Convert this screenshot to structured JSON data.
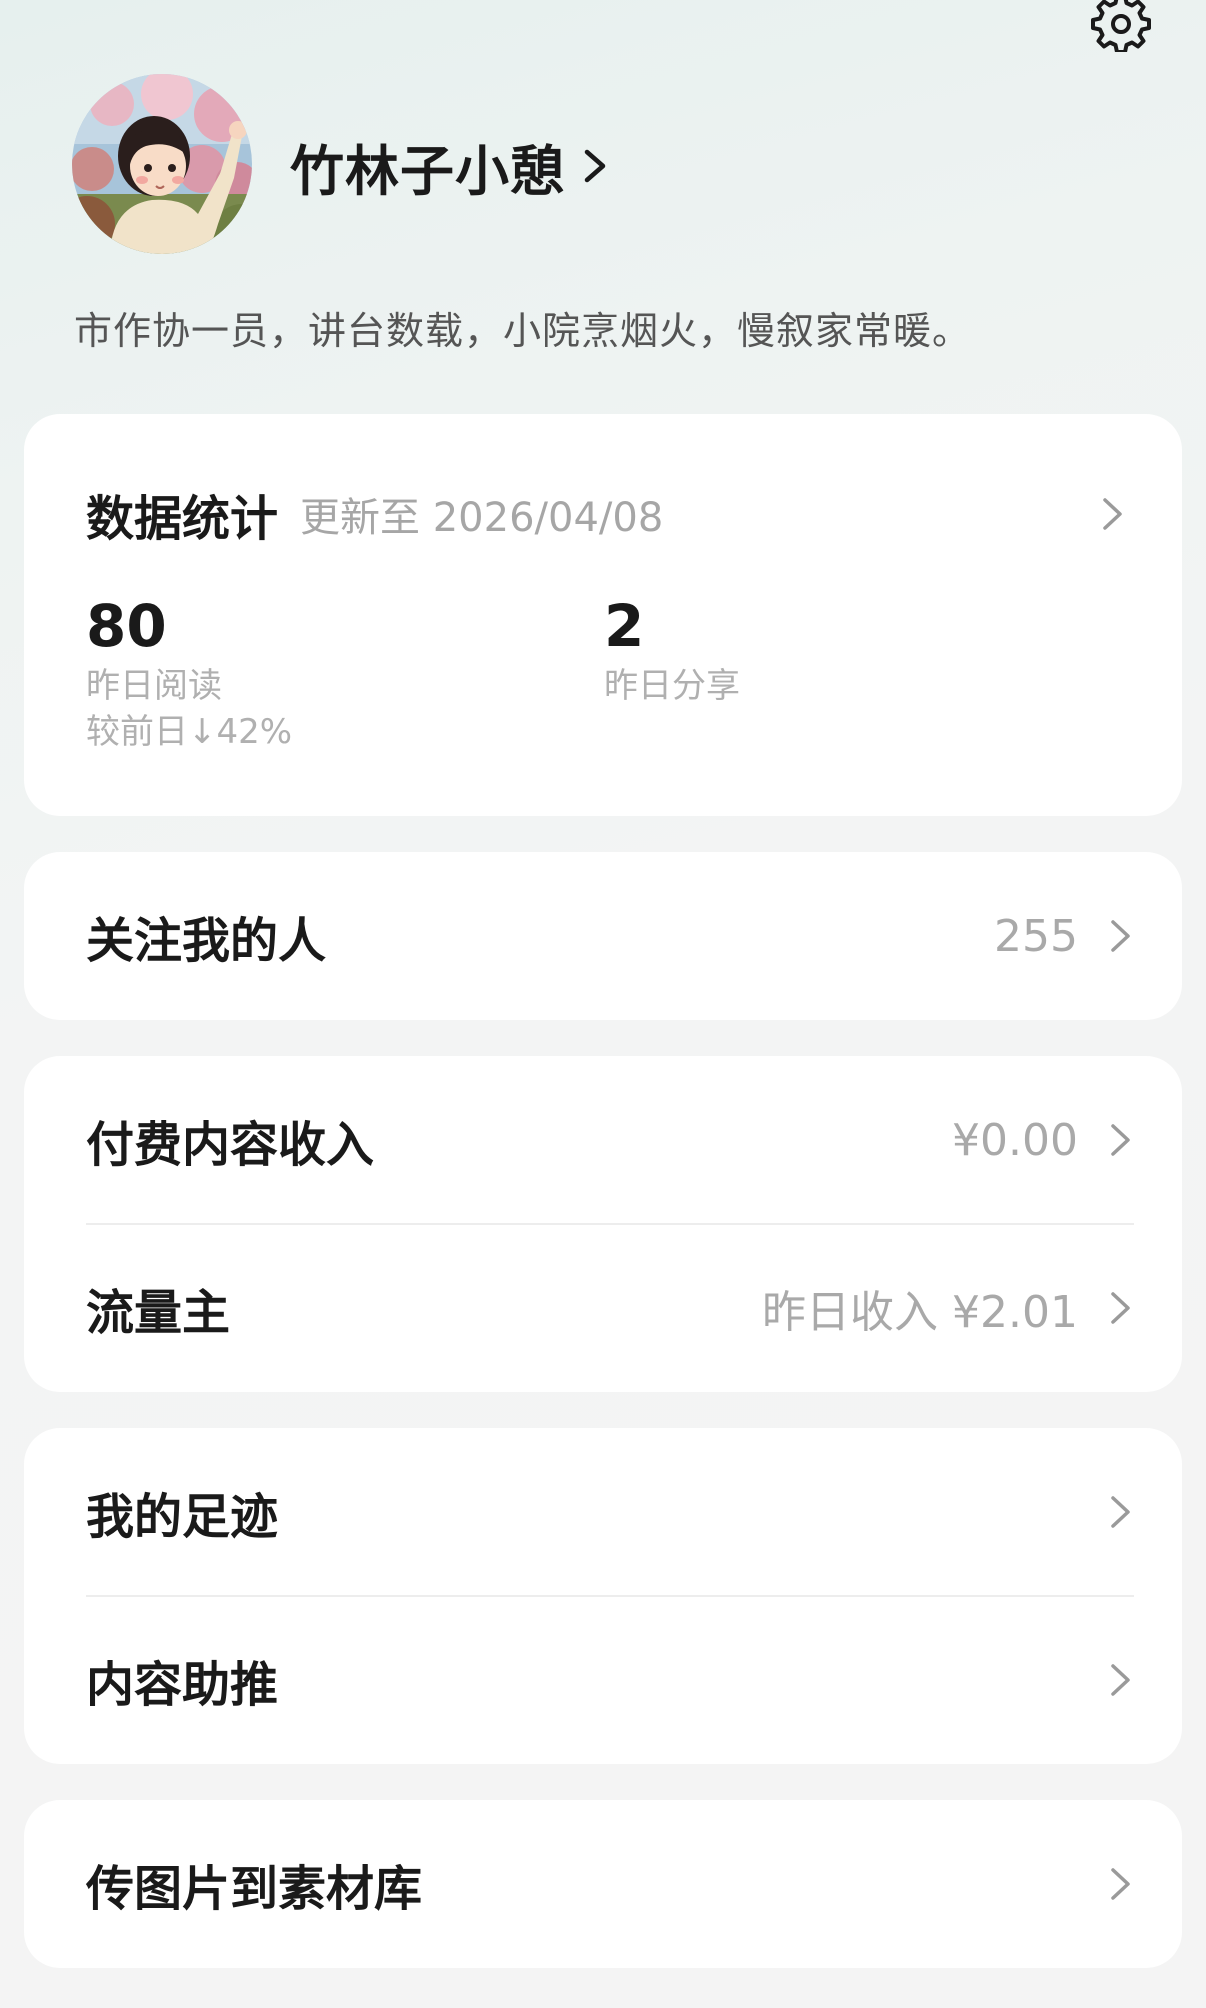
{
  "header": {
    "settings_icon": "gear-icon"
  },
  "profile": {
    "name": "竹林子小憩",
    "bio": "市作协一员，讲台数载，小院烹烟火，慢叙家常暖。",
    "avatar_icon": "avatar-illustration"
  },
  "stats": {
    "title": "数据统计",
    "updated": "更新至 2026/04/08",
    "metrics": [
      {
        "value": "80",
        "label": "昨日阅读",
        "compare": "较前日↓42%"
      },
      {
        "value": "2",
        "label": "昨日分享"
      }
    ]
  },
  "followers": {
    "label": "关注我的人",
    "value": "255"
  },
  "income": {
    "paid_label": "付费内容收入",
    "paid_value": "¥0.00",
    "traffic_label": "流量主",
    "traffic_value": "昨日收入 ¥2.01"
  },
  "tools": {
    "footprint_label": "我的足迹",
    "promote_label": "内容助推"
  },
  "upload": {
    "label": "传图片到素材库"
  },
  "colors": {
    "background": "#f4f4f4",
    "card": "#ffffff",
    "primary_text": "#1a1a1a",
    "secondary_text": "#a9a9a9"
  }
}
